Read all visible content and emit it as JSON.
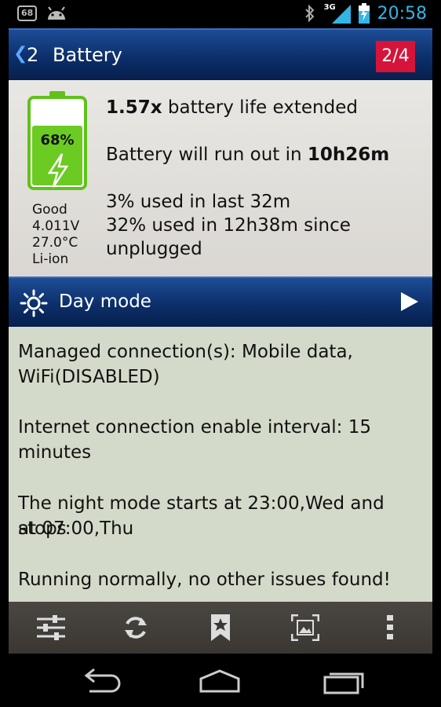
{
  "statusbar": {
    "notification_badge": "68",
    "network": "3G",
    "time": "20:58"
  },
  "header": {
    "back_count": "2",
    "title": "Battery",
    "page_indicator": "2/4"
  },
  "battery": {
    "percent_label": "68%",
    "level": 0.68,
    "health": "Good",
    "voltage": "4.011V",
    "temperature": "27.0°C",
    "type": "Li-ion",
    "extended_value": "1.57x",
    "extended_text": " battery life extended",
    "runout_text": "Battery will run out in ",
    "runout_value": "10h26m",
    "used_recent": "3% used in last 32m",
    "used_since_line1": "32% used in 12h38m since",
    "used_since_line2": "unplugged"
  },
  "mode": {
    "label": "Day mode"
  },
  "info": {
    "managed_prefix": "Managed connection(s): Mobile data,",
    "managed_disabled": "WiFi(DISABLED)",
    "interval_line1": "Internet connection enable interval: 15",
    "interval_line2": "minutes",
    "night_line1": "The night mode starts at 23:00,Wed and stops",
    "night_line2": "at 07:00,Thu",
    "status": "Running normally, no other issues found!"
  },
  "toolbar": {
    "icons": [
      "sliders-icon",
      "refresh-icon",
      "bookmark-star-icon",
      "screenshot-icon",
      "overflow-menu-icon"
    ]
  },
  "colors": {
    "accent_blue": "#0c2f6a",
    "page_badge": "#d6143a",
    "battery_green": "#5fc21a",
    "clock": "#33b5e5"
  }
}
